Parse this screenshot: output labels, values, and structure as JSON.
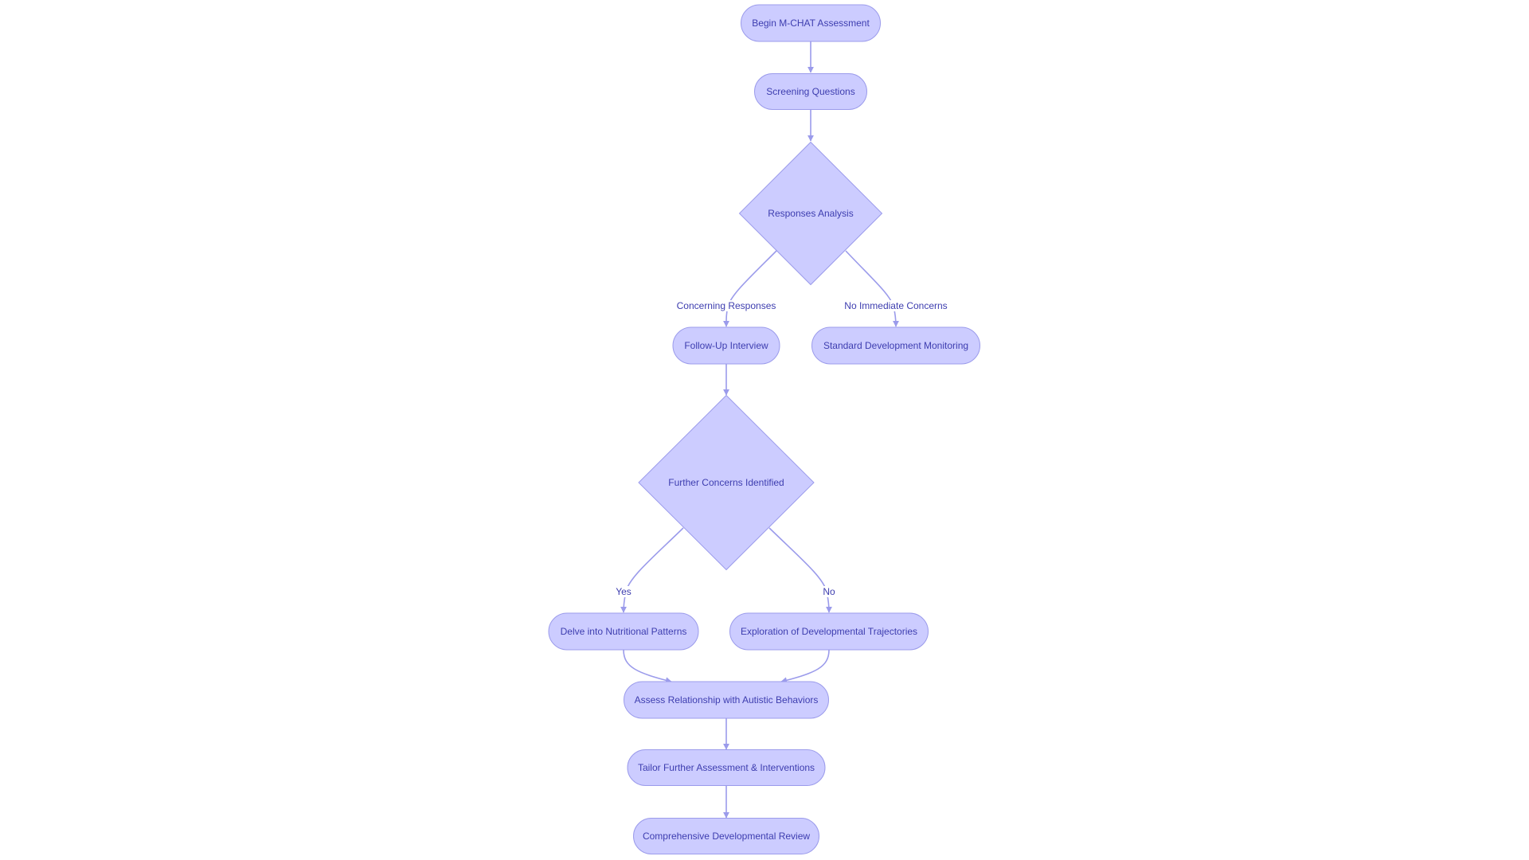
{
  "diagram": {
    "type": "flowchart",
    "direction": "top-down",
    "colors": {
      "node_fill": "#CCCCFF",
      "node_stroke": "#9B9BEB",
      "text": "#3D3DAF",
      "edge": "#9B9BEB",
      "background": "#FFFFFF"
    },
    "nodes": [
      {
        "id": "begin",
        "label": "Begin M-CHAT Assessment",
        "shape": "stadium"
      },
      {
        "id": "screening",
        "label": "Screening Questions",
        "shape": "stadium"
      },
      {
        "id": "analysis",
        "label": "Responses Analysis",
        "shape": "diamond"
      },
      {
        "id": "followup",
        "label": "Follow-Up Interview",
        "shape": "stadium"
      },
      {
        "id": "standard",
        "label": "Standard Development Monitoring",
        "shape": "stadium"
      },
      {
        "id": "further",
        "label": "Further Concerns Identified",
        "shape": "diamond"
      },
      {
        "id": "delve",
        "label": "Delve into Nutritional Patterns",
        "shape": "stadium"
      },
      {
        "id": "exploration",
        "label": "Exploration of Developmental Trajectories",
        "shape": "stadium"
      },
      {
        "id": "assess",
        "label": "Assess Relationship with Autistic Behaviors",
        "shape": "stadium"
      },
      {
        "id": "tailor",
        "label": "Tailor Further Assessment & Interventions",
        "shape": "stadium"
      },
      {
        "id": "review",
        "label": "Comprehensive Developmental Review",
        "shape": "stadium"
      }
    ],
    "edges": [
      {
        "from": "begin",
        "to": "screening",
        "label": ""
      },
      {
        "from": "screening",
        "to": "analysis",
        "label": ""
      },
      {
        "from": "analysis",
        "to": "followup",
        "label": "Concerning Responses"
      },
      {
        "from": "analysis",
        "to": "standard",
        "label": "No Immediate Concerns"
      },
      {
        "from": "followup",
        "to": "further",
        "label": ""
      },
      {
        "from": "further",
        "to": "delve",
        "label": "Yes"
      },
      {
        "from": "further",
        "to": "exploration",
        "label": "No"
      },
      {
        "from": "delve",
        "to": "assess",
        "label": ""
      },
      {
        "from": "exploration",
        "to": "assess",
        "label": ""
      },
      {
        "from": "assess",
        "to": "tailor",
        "label": ""
      },
      {
        "from": "tailor",
        "to": "review",
        "label": ""
      }
    ]
  }
}
